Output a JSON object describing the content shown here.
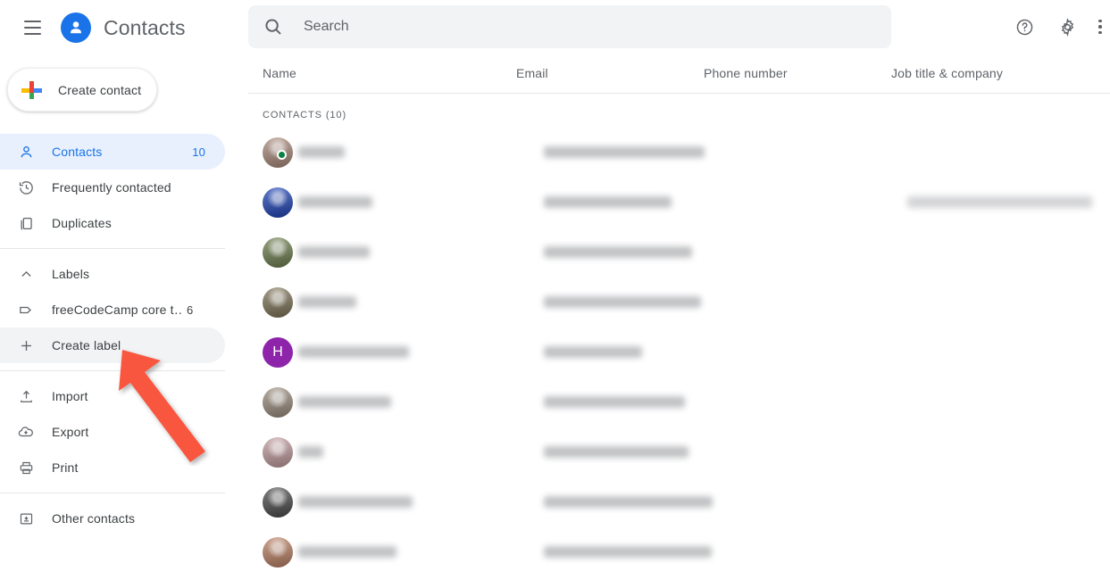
{
  "app": {
    "title": "Contacts",
    "logo_icon": "contacts-person-icon",
    "menu_icon": "hamburger-menu-icon"
  },
  "colors": {
    "brand_blue": "#1a73e8",
    "active_pill": "#e8f0fe",
    "hover_pill": "#f1f3f4",
    "search_bg": "#f1f3f4",
    "text_primary": "#3c4043",
    "text_secondary": "#5f6368",
    "divider": "#e4e6e8",
    "annotation_arrow": "#f9563f",
    "presence_online": "#0b8043",
    "letter_avatar_purple": "#8e24aa"
  },
  "sidebar": {
    "create_contact": {
      "label": "Create contact",
      "icon": "google-plus-icon"
    },
    "groups": [
      {
        "items": [
          {
            "label": "Contacts",
            "icon": "person-outline-icon",
            "count": "10",
            "state": "active"
          },
          {
            "label": "Frequently contacted",
            "icon": "history-icon",
            "count": "",
            "state": "default"
          },
          {
            "label": "Duplicates",
            "icon": "copy-icon",
            "count": "",
            "state": "default"
          }
        ]
      },
      {
        "items": [
          {
            "label": "Labels",
            "icon": "chevron-up-icon",
            "count": "",
            "state": "default"
          },
          {
            "label": "freeCodeCamp core t…",
            "icon": "label-tag-icon",
            "count": "6",
            "state": "default"
          },
          {
            "label": "Create label",
            "icon": "plus-icon",
            "count": "",
            "state": "hover"
          }
        ]
      },
      {
        "items": [
          {
            "label": "Import",
            "icon": "upload-icon",
            "count": "",
            "state": "default"
          },
          {
            "label": "Export",
            "icon": "cloud-download-icon",
            "count": "",
            "state": "default"
          },
          {
            "label": "Print",
            "icon": "printer-icon",
            "count": "",
            "state": "default"
          }
        ]
      },
      {
        "items": [
          {
            "label": "Other contacts",
            "icon": "archive-box-icon",
            "count": "",
            "state": "default"
          }
        ]
      }
    ]
  },
  "topbar": {
    "search": {
      "placeholder": "Search",
      "value": "",
      "icon": "search-icon"
    },
    "actions": [
      {
        "name": "help-icon",
        "label": "Help"
      },
      {
        "name": "gear-icon",
        "label": "Settings"
      },
      {
        "name": "kebab-menu-icon",
        "label": "More options"
      }
    ]
  },
  "table": {
    "columns": [
      {
        "key": "name",
        "label": "Name"
      },
      {
        "key": "email",
        "label": "Email"
      },
      {
        "key": "phone",
        "label": "Phone number"
      },
      {
        "key": "job",
        "label": "Job title & company"
      }
    ],
    "section_label": "CONTACTS (10)",
    "rows": [
      {
        "name": "",
        "email": "",
        "phone": "",
        "job": "",
        "name_redacted_w": 52,
        "email_redacted_w": 180,
        "job_redacted_w": 0,
        "avatar_type": "photo",
        "avatar_color": "#a9887a",
        "avatar_letter": "",
        "presence": "online"
      },
      {
        "name": "",
        "email": "",
        "phone": "",
        "job": "",
        "name_redacted_w": 83,
        "email_redacted_w": 143,
        "job_redacted_w": 207,
        "avatar_type": "photo",
        "avatar_color": "#1e43b5",
        "avatar_letter": "",
        "presence": ""
      },
      {
        "name": "",
        "email": "",
        "phone": "",
        "job": "",
        "name_redacted_w": 80,
        "email_redacted_w": 166,
        "job_redacted_w": 0,
        "avatar_type": "photo",
        "avatar_color": "#6c7d4e",
        "avatar_letter": "",
        "presence": ""
      },
      {
        "name": "",
        "email": "",
        "phone": "",
        "job": "",
        "name_redacted_w": 65,
        "email_redacted_w": 176,
        "job_redacted_w": 0,
        "avatar_type": "photo",
        "avatar_color": "#7d7356",
        "avatar_letter": "",
        "presence": ""
      },
      {
        "name": "",
        "email": "",
        "phone": "",
        "job": "",
        "name_redacted_w": 124,
        "email_redacted_w": 110,
        "job_redacted_w": 0,
        "avatar_type": "letter",
        "avatar_color": "#8e24aa",
        "avatar_letter": "H",
        "presence": ""
      },
      {
        "name": "",
        "email": "",
        "phone": "",
        "job": "",
        "name_redacted_w": 104,
        "email_redacted_w": 158,
        "job_redacted_w": 0,
        "avatar_type": "photo",
        "avatar_color": "#9a8c7d",
        "avatar_letter": "",
        "presence": ""
      },
      {
        "name": "",
        "email": "",
        "phone": "",
        "job": "",
        "name_redacted_w": 28,
        "email_redacted_w": 162,
        "job_redacted_w": 0,
        "avatar_type": "photo",
        "avatar_color": "#c09a9c",
        "avatar_letter": "",
        "presence": ""
      },
      {
        "name": "",
        "email": "",
        "phone": "",
        "job": "",
        "name_redacted_w": 128,
        "email_redacted_w": 189,
        "job_redacted_w": 0,
        "avatar_type": "photo",
        "avatar_color": "#4a4a4a",
        "avatar_letter": "",
        "presence": ""
      },
      {
        "name": "",
        "email": "",
        "phone": "",
        "job": "",
        "name_redacted_w": 110,
        "email_redacted_w": 188,
        "job_redacted_w": 0,
        "avatar_type": "photo",
        "avatar_color": "#b97f63",
        "avatar_letter": "",
        "presence": ""
      }
    ]
  },
  "annotation": {
    "type": "arrow",
    "points_to": "Create label",
    "color": "#f9563f"
  }
}
